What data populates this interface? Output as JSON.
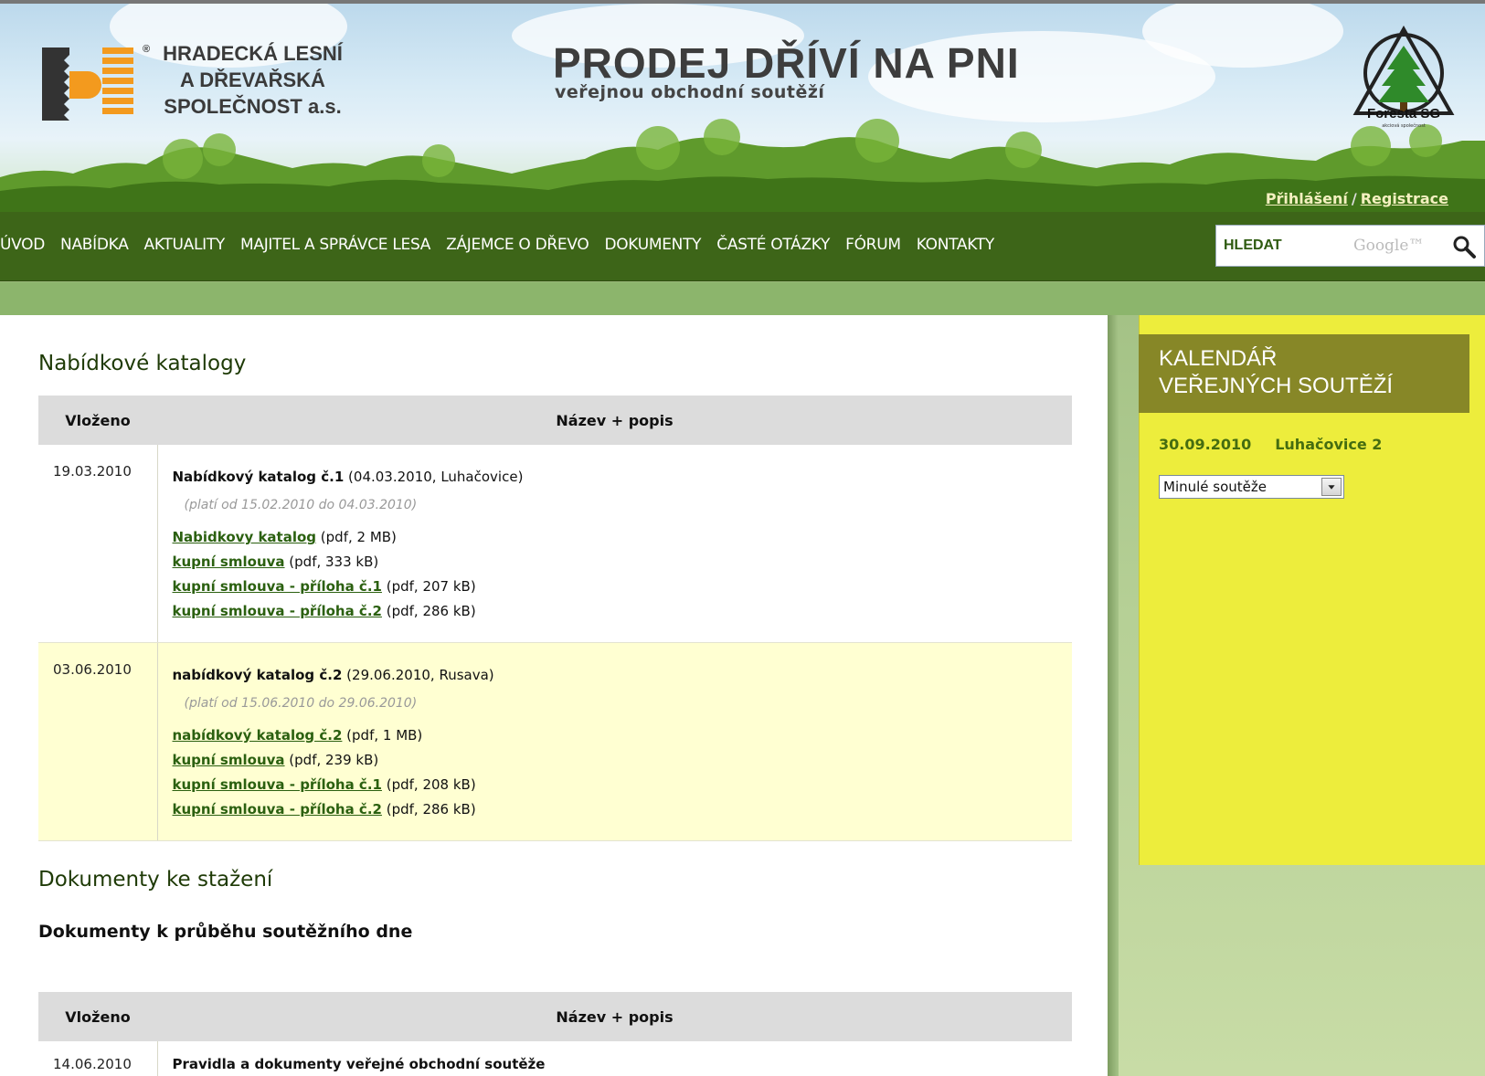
{
  "header": {
    "logo_left": {
      "line1": "HRADECKÁ LESNÍ",
      "line2": "A DŘEVAŘSKÁ",
      "line3": "SPOLEČNOST a.s.",
      "registered": "®"
    },
    "title": "PRODEJ DŘÍVÍ NA PNI",
    "subtitle": "veřejnou obchodní soutěží",
    "logo_right": {
      "name": "Foresta SG",
      "tagline": "akciová společnost"
    },
    "login_label": "Přihlášení",
    "register_label": "Registrace",
    "separator": "/"
  },
  "nav": {
    "items": [
      "ÚVOD",
      "NABÍDKA",
      "AKTUALITY",
      "MAJITEL A SPRÁVCE LESA",
      "ZÁJEMCE O DŘEVO",
      "DOKUMENTY",
      "ČASTÉ OTÁZKY",
      "FÓRUM",
      "KONTAKTY"
    ],
    "search_label": "HLEDAT",
    "search_brand": "Google™",
    "search_icon": "magnifier-icon"
  },
  "catalogs": {
    "heading": "Nabídkové katalogy",
    "col_date": "Vloženo",
    "col_desc": "Název + popis",
    "rows": [
      {
        "date": "19.03.2010",
        "title": "Nabídkový katalog č.1",
        "meta": " (04.03.2010, Luhačovice)",
        "validity": "(platí od 15.02.2010 do 04.03.2010)",
        "files": [
          {
            "link": "Nabidkovy katalog",
            "info": " (pdf, 2 MB)"
          },
          {
            "link": "kupní smlouva",
            "info": " (pdf, 333 kB)"
          },
          {
            "link": "kupní smlouva - příloha č.1",
            "info": " (pdf, 207 kB)"
          },
          {
            "link": "kupní smlouva - příloha č.2",
            "info": " (pdf, 286 kB)"
          }
        ]
      },
      {
        "date": "03.06.2010",
        "title": "nabídkový katalog č.2",
        "meta": " (29.06.2010, Rusava)",
        "validity": "(platí od 15.06.2010 do 29.06.2010)",
        "files": [
          {
            "link": "nabídkový katalog č.2",
            "info": " (pdf, 1 MB)"
          },
          {
            "link": "kupní smlouva",
            "info": " (pdf, 239 kB)"
          },
          {
            "link": "kupní smlouva - příloha č.1",
            "info": " (pdf, 208 kB)"
          },
          {
            "link": "kupní smlouva - příloha č.2",
            "info": " (pdf, 286 kB)"
          }
        ]
      }
    ]
  },
  "downloads": {
    "heading": "Dokumenty ke stažení",
    "subheading": "Dokumenty k průběhu soutěžního dne",
    "col_date": "Vloženo",
    "col_desc": "Název + popis",
    "rows": [
      {
        "date": "14.06.2010",
        "title": "Pravidla a dokumenty veřejné obchodní soutěže"
      }
    ]
  },
  "sidebar": {
    "title_line1": "KALENDÁŘ",
    "title_line2": "VEŘEJNÝCH SOUTĚŽÍ",
    "event_date": "30.09.2010",
    "event_place": "Luhačovice 2",
    "select_value": "Minulé soutěže"
  },
  "colors": {
    "nav_bg": "#3d6518",
    "link": "#2b6010",
    "calendar_bg": "#eded3c",
    "calendar_head": "#878727",
    "row_highlight": "#ffffd2"
  }
}
